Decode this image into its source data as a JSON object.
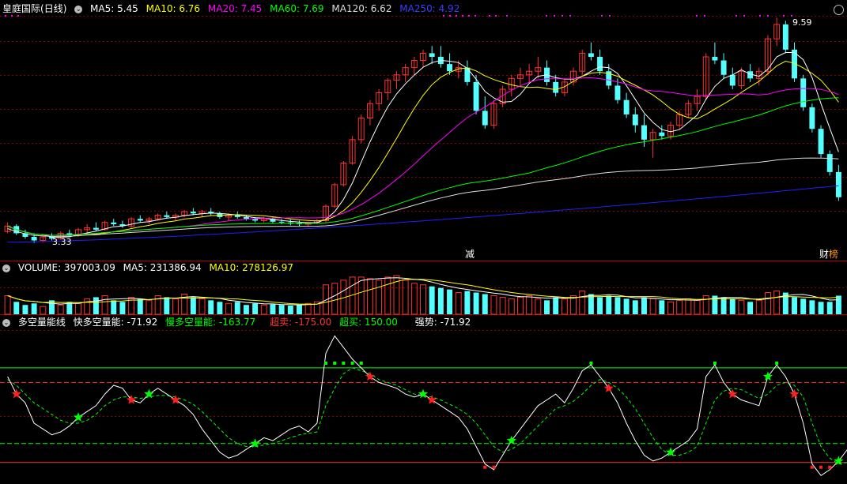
{
  "colors": {
    "up": "#ff3232",
    "down": "#54ffff",
    "ma5": "#ffffff",
    "ma10": "#ffff00",
    "ma20": "#ff00ff",
    "ma60": "#00ff00",
    "ma120": "#dcdcdc",
    "ma250": "#2020ff",
    "grid": "#8b0000",
    "volma5": "#ffffff",
    "volma10": "#ffff00",
    "fast": "#ffffff",
    "slow": "#00ff00",
    "oversold": "#ff3232",
    "overbought": "#00ff00"
  },
  "header": {
    "stock_name": "皇庭国际",
    "period": "(日线)",
    "ma5": "MA5: 5.45",
    "ma10": "MA10: 6.76",
    "ma20": "MA20: 7.45",
    "ma60": "MA60: 7.69",
    "ma120": "MA120: 6.62",
    "ma250": "MA250: 4.92"
  },
  "price_labels": {
    "high": "9.59",
    "low": "3.33",
    "event_jian": "减",
    "event_cai": "财",
    "event_bang": "榜"
  },
  "volume_header": {
    "volume": "VOLUME: 397003.09",
    "ma5": "MA5: 231386.94",
    "ma10": "MA10: 278126.97"
  },
  "indicator_header": {
    "name": "多空量能线",
    "fast": "快多空量能: -71.92",
    "slow": "慢多空量能: -163.77",
    "oversold": "超卖: -175.00",
    "overbought": "超买: 150.00",
    "strength": "强势: -71.92"
  },
  "chart_data": {
    "type": "candlestick",
    "price_range": [
      3.33,
      9.59
    ],
    "ohlc": [
      [
        3.65,
        3.9,
        3.6,
        3.8
      ],
      [
        3.8,
        3.85,
        3.55,
        3.6
      ],
      [
        3.6,
        3.7,
        3.45,
        3.5
      ],
      [
        3.5,
        3.6,
        3.33,
        3.4
      ],
      [
        3.4,
        3.55,
        3.35,
        3.5
      ],
      [
        3.5,
        3.6,
        3.4,
        3.45
      ],
      [
        3.45,
        3.65,
        3.42,
        3.6
      ],
      [
        3.6,
        3.7,
        3.5,
        3.55
      ],
      [
        3.55,
        3.75,
        3.5,
        3.7
      ],
      [
        3.7,
        3.85,
        3.6,
        3.75
      ],
      [
        3.75,
        3.9,
        3.65,
        3.7
      ],
      [
        3.7,
        3.95,
        3.68,
        3.9
      ],
      [
        3.9,
        4.0,
        3.8,
        3.85
      ],
      [
        3.85,
        3.95,
        3.75,
        3.8
      ],
      [
        3.8,
        4.05,
        3.75,
        4.0
      ],
      [
        4.0,
        4.1,
        3.9,
        3.95
      ],
      [
        3.95,
        4.05,
        3.85,
        4.0
      ],
      [
        4.0,
        4.15,
        3.95,
        4.1
      ],
      [
        4.1,
        4.2,
        4.0,
        4.05
      ],
      [
        4.05,
        4.15,
        3.95,
        4.1
      ],
      [
        4.1,
        4.25,
        4.05,
        4.2
      ],
      [
        4.2,
        4.3,
        4.1,
        4.15
      ],
      [
        4.15,
        4.25,
        4.05,
        4.2
      ],
      [
        4.2,
        4.3,
        4.1,
        4.15
      ],
      [
        4.15,
        4.2,
        4.0,
        4.05
      ],
      [
        4.05,
        4.15,
        3.95,
        4.1
      ],
      [
        4.1,
        4.2,
        4.0,
        4.05
      ],
      [
        4.05,
        4.1,
        3.95,
        4.0
      ],
      [
        4.0,
        4.05,
        3.9,
        3.95
      ],
      [
        3.95,
        4.05,
        3.9,
        4.0
      ],
      [
        4.0,
        4.05,
        3.88,
        3.92
      ],
      [
        3.92,
        4.0,
        3.85,
        3.9
      ],
      [
        3.9,
        3.98,
        3.82,
        3.88
      ],
      [
        3.88,
        3.95,
        3.8,
        3.85
      ],
      [
        3.85,
        3.92,
        3.78,
        3.9
      ],
      [
        3.9,
        4.0,
        3.85,
        3.95
      ],
      [
        3.95,
        4.4,
        3.9,
        4.35
      ],
      [
        4.35,
        5.0,
        4.3,
        4.95
      ],
      [
        4.95,
        5.6,
        4.9,
        5.55
      ],
      [
        5.55,
        6.3,
        5.5,
        6.2
      ],
      [
        6.2,
        6.9,
        6.1,
        6.8
      ],
      [
        6.8,
        7.3,
        6.6,
        7.2
      ],
      [
        7.2,
        7.6,
        7.0,
        7.5
      ],
      [
        7.5,
        7.9,
        7.3,
        7.85
      ],
      [
        7.85,
        8.1,
        7.6,
        8.0
      ],
      [
        8.0,
        8.3,
        7.8,
        8.2
      ],
      [
        8.2,
        8.5,
        8.0,
        8.4
      ],
      [
        8.4,
        8.7,
        8.2,
        8.6
      ],
      [
        8.6,
        8.8,
        8.3,
        8.5
      ],
      [
        8.5,
        8.8,
        8.2,
        8.3
      ],
      [
        8.3,
        8.6,
        8.0,
        8.1
      ],
      [
        8.1,
        8.4,
        7.9,
        8.2
      ],
      [
        8.2,
        8.4,
        7.7,
        7.8
      ],
      [
        7.8,
        8.0,
        6.9,
        7.0
      ],
      [
        7.0,
        7.4,
        6.5,
        6.6
      ],
      [
        6.6,
        7.3,
        6.5,
        7.2
      ],
      [
        7.2,
        7.7,
        7.1,
        7.6
      ],
      [
        7.6,
        8.0,
        7.4,
        7.9
      ],
      [
        7.9,
        8.2,
        7.7,
        8.0
      ],
      [
        8.0,
        8.3,
        7.8,
        8.1
      ],
      [
        8.1,
        8.5,
        7.9,
        8.2
      ],
      [
        8.2,
        8.4,
        7.7,
        7.8
      ],
      [
        7.8,
        8.0,
        7.4,
        7.5
      ],
      [
        7.5,
        7.9,
        7.4,
        7.8
      ],
      [
        7.8,
        8.2,
        7.7,
        8.1
      ],
      [
        8.1,
        8.7,
        8.0,
        8.6
      ],
      [
        8.6,
        8.9,
        8.4,
        8.5
      ],
      [
        8.5,
        8.7,
        8.0,
        8.1
      ],
      [
        8.1,
        8.3,
        7.6,
        7.7
      ],
      [
        7.7,
        7.9,
        7.2,
        7.3
      ],
      [
        7.3,
        7.5,
        6.8,
        6.9
      ],
      [
        6.9,
        7.1,
        6.4,
        6.6
      ],
      [
        6.6,
        6.9,
        6.0,
        6.2
      ],
      [
        6.2,
        6.5,
        5.7,
        6.4
      ],
      [
        6.4,
        6.6,
        6.2,
        6.3
      ],
      [
        6.3,
        6.7,
        6.2,
        6.6
      ],
      [
        6.6,
        7.0,
        6.5,
        6.9
      ],
      [
        6.9,
        7.3,
        6.8,
        7.2
      ],
      [
        7.2,
        7.6,
        7.0,
        7.4
      ],
      [
        7.4,
        8.6,
        7.3,
        8.5
      ],
      [
        8.5,
        8.9,
        8.3,
        8.4
      ],
      [
        8.4,
        8.6,
        7.9,
        8.0
      ],
      [
        8.0,
        8.2,
        7.6,
        7.7
      ],
      [
        7.7,
        8.2,
        7.6,
        8.1
      ],
      [
        8.1,
        8.3,
        7.8,
        7.9
      ],
      [
        7.9,
        8.2,
        7.7,
        8.1
      ],
      [
        8.1,
        9.1,
        8.0,
        9.0
      ],
      [
        9.0,
        9.59,
        8.8,
        9.4
      ],
      [
        9.4,
        9.5,
        8.6,
        8.7
      ],
      [
        8.7,
        8.9,
        7.8,
        7.9
      ],
      [
        7.9,
        8.0,
        7.0,
        7.1
      ],
      [
        7.1,
        7.2,
        6.4,
        6.5
      ],
      [
        6.5,
        6.6,
        5.7,
        5.8
      ],
      [
        5.8,
        5.9,
        5.2,
        5.3
      ],
      [
        5.3,
        5.5,
        4.5,
        4.6
      ]
    ],
    "volume": [
      60,
      40,
      30,
      35,
      25,
      45,
      30,
      40,
      35,
      50,
      55,
      60,
      45,
      40,
      55,
      50,
      45,
      60,
      55,
      50,
      65,
      55,
      50,
      45,
      40,
      35,
      40,
      30,
      35,
      30,
      32,
      30,
      28,
      30,
      35,
      40,
      95,
      100,
      110,
      120,
      120,
      115,
      110,
      120,
      125,
      110,
      100,
      95,
      90,
      85,
      80,
      70,
      75,
      70,
      65,
      60,
      55,
      50,
      55,
      60,
      50,
      45,
      55,
      50,
      60,
      75,
      65,
      55,
      60,
      55,
      50,
      45,
      55,
      50,
      45,
      40,
      45,
      50,
      45,
      60,
      60,
      55,
      50,
      45,
      40,
      45,
      70,
      75,
      70,
      55,
      50,
      45,
      40,
      40,
      60
    ],
    "volume_range": [
      0,
      130
    ],
    "fast_line": [
      120,
      60,
      30,
      -40,
      -60,
      -80,
      -70,
      -50,
      -20,
      0,
      20,
      60,
      90,
      80,
      40,
      30,
      60,
      80,
      60,
      40,
      20,
      -10,
      -60,
      -100,
      -140,
      -160,
      -150,
      -130,
      -110,
      -90,
      -100,
      -80,
      -60,
      -50,
      -70,
      -40,
      200,
      260,
      220,
      180,
      150,
      120,
      100,
      90,
      80,
      60,
      50,
      60,
      40,
      20,
      0,
      -20,
      -60,
      -120,
      -180,
      -200,
      -150,
      -100,
      -60,
      -20,
      20,
      40,
      60,
      30,
      80,
      140,
      160,
      120,
      80,
      30,
      -40,
      -100,
      -150,
      -170,
      -160,
      -140,
      -120,
      -100,
      -60,
      120,
      160,
      100,
      60,
      40,
      30,
      20,
      120,
      160,
      120,
      60,
      -40,
      -180,
      -220,
      -200,
      -170,
      -130
    ],
    "slow_line": [
      110,
      90,
      60,
      30,
      10,
      -10,
      -30,
      -40,
      -40,
      -30,
      -10,
      20,
      40,
      50,
      50,
      45,
      50,
      55,
      55,
      50,
      40,
      25,
      0,
      -30,
      -60,
      -90,
      -110,
      -120,
      -120,
      -115,
      -110,
      -100,
      -90,
      -80,
      -75,
      -70,
      20,
      80,
      130,
      150,
      140,
      130,
      110,
      100,
      90,
      75,
      60,
      55,
      50,
      40,
      25,
      10,
      -10,
      -40,
      -80,
      -120,
      -140,
      -130,
      -110,
      -80,
      -50,
      -20,
      10,
      20,
      35,
      60,
      90,
      110,
      100,
      80,
      50,
      10,
      -40,
      -90,
      -130,
      -150,
      -150,
      -140,
      -120,
      -40,
      40,
      70,
      80,
      75,
      60,
      45,
      60,
      90,
      100,
      90,
      50,
      -40,
      -120,
      -160,
      -180,
      -175
    ],
    "indicator_range": [
      -230,
      280
    ],
    "levels": {
      "oversold": -175,
      "overbought": 150,
      "mid_high": 100,
      "mid_low": -110
    }
  }
}
